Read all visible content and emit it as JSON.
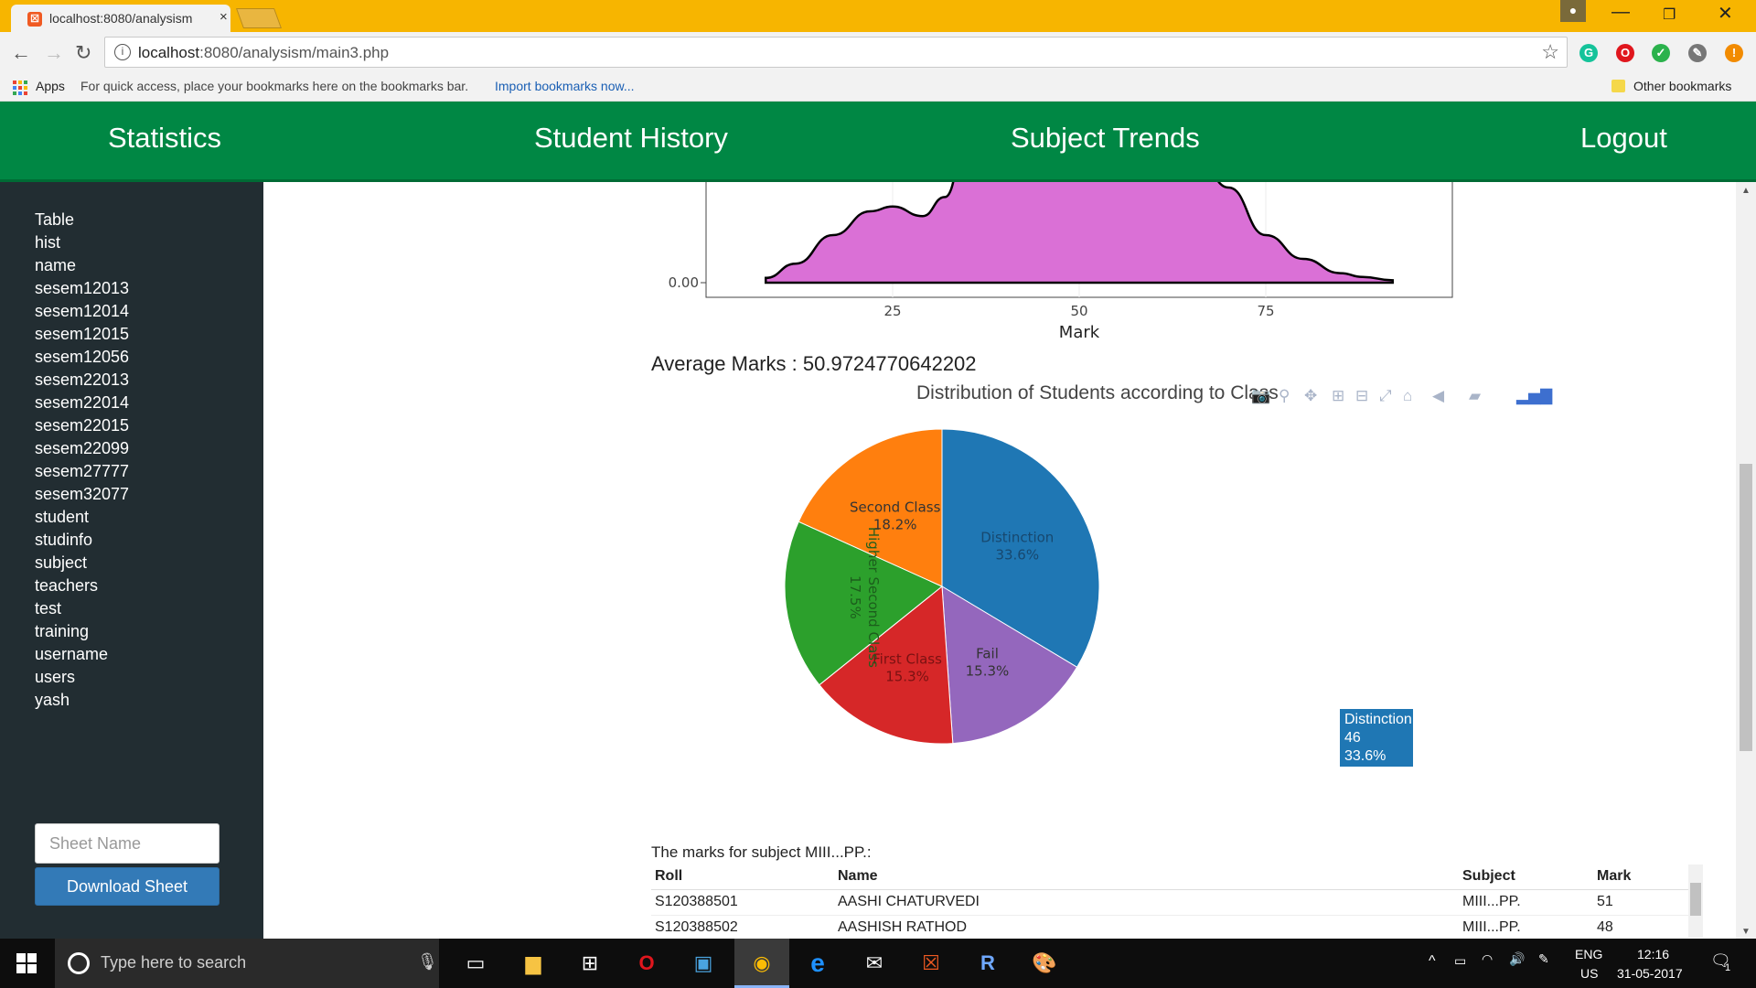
{
  "browser": {
    "tab_title": "localhost:8080/analysism",
    "tab_close": "×",
    "url_host": "localhost",
    "url_rest": ":8080/analysism/main3.php",
    "bookmarks_apps": "Apps",
    "bookmarks_hint": "For quick access, place your bookmarks here on the bookmarks bar.",
    "bookmarks_import": "Import bookmarks now...",
    "other_bookmarks": "Other bookmarks"
  },
  "nav": {
    "items": [
      "Statistics",
      "Student History",
      "Subject Trends",
      "Logout"
    ]
  },
  "sidebar": {
    "items": [
      "Table",
      "hist",
      "name",
      "sesem12013",
      "sesem12014",
      "sesem12015",
      "sesem12056",
      "sesem22013",
      "sesem22014",
      "sesem22015",
      "sesem22099",
      "sesem27777",
      "sesem32077",
      "student",
      "studinfo",
      "subject",
      "teachers",
      "test",
      "training",
      "username",
      "users",
      "yash"
    ],
    "sheet_placeholder": "Sheet Name",
    "download_label": "Download Sheet"
  },
  "average": {
    "text": "Average Marks : 50.9724770642202"
  },
  "chart_data": [
    {
      "type": "area",
      "xlabel": "Mark",
      "ylabel": "",
      "x_ticks": [
        "25",
        "50",
        "75"
      ],
      "y_ticks": [
        "0.00"
      ],
      "xlim": [
        0,
        100
      ],
      "fill_color": "#da70d6",
      "x": [
        8,
        12,
        17,
        22,
        25,
        29,
        32,
        35,
        40,
        50,
        60,
        65,
        70,
        75,
        80,
        85,
        88,
        92
      ],
      "y": [
        0.001,
        0.004,
        0.01,
        0.015,
        0.016,
        0.014,
        0.018,
        0.03,
        0.04,
        0.042,
        0.04,
        0.03,
        0.02,
        0.01,
        0.005,
        0.002,
        0.0012,
        0.0005
      ],
      "ylim": [
        0,
        0.025
      ]
    },
    {
      "type": "pie",
      "title": "Distribution of Students according to Class",
      "slices": [
        {
          "label": "Distinction",
          "value": 46,
          "percent": "33.6%",
          "color": "#1f77b4"
        },
        {
          "label": "Fail",
          "value": 21,
          "percent": "15.3%",
          "color": "#9467bd"
        },
        {
          "label": "First Class",
          "value": 21,
          "percent": "15.3%",
          "color": "#d62728"
        },
        {
          "label": "Higher Second Class",
          "value": 24,
          "percent": "17.5%",
          "color": "#2ca02c"
        },
        {
          "label": "Second Class",
          "value": 25,
          "percent": "18.2%",
          "color": "#ff7f0e"
        }
      ],
      "tooltip": {
        "label": "Distinction",
        "count": "46",
        "percent": "33.6%"
      }
    }
  ],
  "marks_table": {
    "caption": "The marks for subject MIII...PP.:",
    "headers": [
      "Roll",
      "Name",
      "Subject",
      "Mark"
    ],
    "rows": [
      [
        "S120388501",
        "AASHI CHATURVEDI",
        "MIII...PP.",
        "51"
      ],
      [
        "S120388502",
        "AASHISH RATHOD",
        "MIII...PP.",
        "48"
      ]
    ]
  },
  "taskbar": {
    "search_placeholder": "Type here to search",
    "lang_top": "ENG",
    "lang_bottom": "US",
    "time": "12:16",
    "date": "31-05-2017",
    "notif_count": "1"
  }
}
